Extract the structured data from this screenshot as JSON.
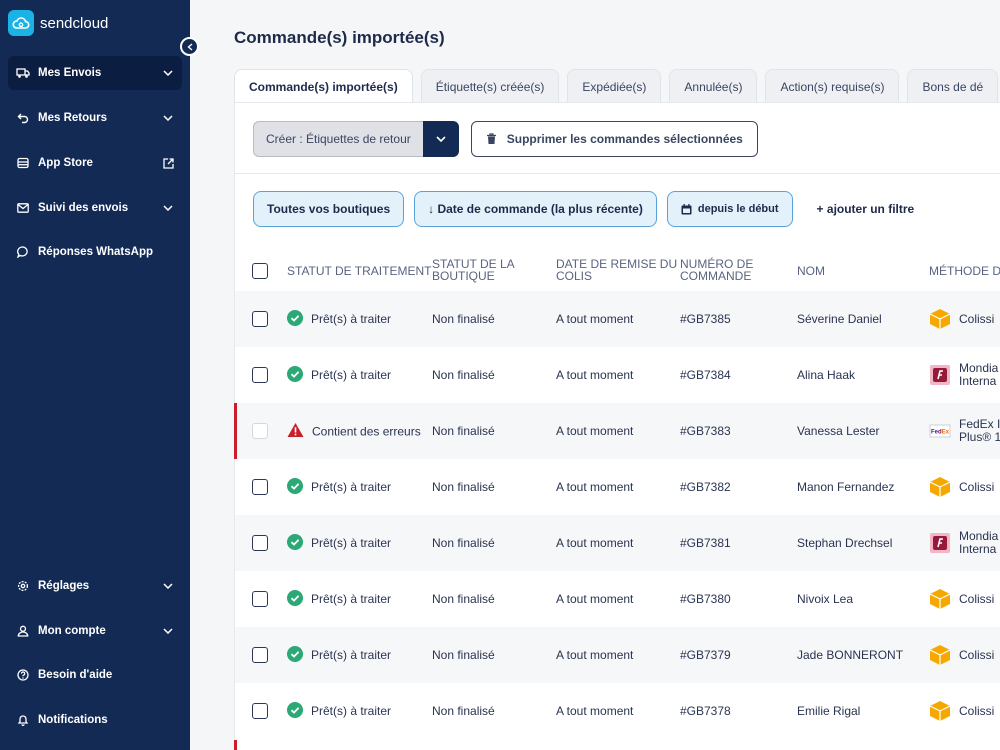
{
  "app": {
    "logo_text": "sendcloud"
  },
  "sidebar": {
    "top_items": [
      {
        "label": "Mes Envois",
        "icon": "truck-icon",
        "has_chevron": true,
        "active": true
      },
      {
        "label": "Mes Retours",
        "icon": "return-arrow-icon",
        "has_chevron": true
      },
      {
        "label": "App Store",
        "icon": "store-icon",
        "external": true
      },
      {
        "label": "Suivi des envois",
        "icon": "mail-icon",
        "has_chevron": true
      },
      {
        "label": "Réponses WhatsApp",
        "icon": "chat-bubble-icon"
      }
    ],
    "bottom_items": [
      {
        "label": "Réglages",
        "icon": "gear-icon",
        "has_chevron": true
      },
      {
        "label": "Mon compte",
        "icon": "user-icon",
        "has_chevron": true
      },
      {
        "label": "Besoin d'aide",
        "icon": "help-icon"
      },
      {
        "label": "Notifications",
        "icon": "bell-icon"
      }
    ]
  },
  "page": {
    "title": "Commande(s) importée(s)"
  },
  "tabs": [
    {
      "label": "Commande(s) importée(s)",
      "active": true
    },
    {
      "label": "Étiquette(s) créée(s)"
    },
    {
      "label": "Expédiée(s)"
    },
    {
      "label": "Annulée(s)"
    },
    {
      "label": "Action(s) requise(s)"
    },
    {
      "label": "Bons de dé"
    }
  ],
  "actions": {
    "create_label": "Créer : Étiquettes de retour",
    "delete_label": "Supprimer les commandes sélectionnées"
  },
  "filters": {
    "shops": "Toutes vos boutiques",
    "sort": "↓ Date de commande (la plus récente)",
    "date": "depuis le début",
    "add": "+ ajouter un filtre"
  },
  "table": {
    "headers": {
      "status": "STATUT DE TRAITEMENT",
      "shop_status_1": "STATUT DE LA",
      "shop_status_2": "BOUTIQUE",
      "handover_1": "DATE DE REMISE DU",
      "handover_2": "COLIS",
      "order_1": "NUMÉRO DE",
      "order_2": "COMMANDE",
      "name": "NOM",
      "method": "MÉTHODE D'"
    },
    "rows": [
      {
        "status": "Prêt(s) à traiter",
        "status_type": "ok",
        "shop_status": "Non finalisé",
        "handover": "A tout moment",
        "order": "#GB7385",
        "name": "Séverine Daniel",
        "carrier_type": "colissimo",
        "method_1": "Colissi",
        "method_2": ""
      },
      {
        "status": "Prêt(s) à traiter",
        "status_type": "ok",
        "shop_status": "Non finalisé",
        "handover": "A tout moment",
        "order": "#GB7384",
        "name": "Alina Haak",
        "carrier_type": "mondial",
        "method_1": "Mondia",
        "method_2": "Interna"
      },
      {
        "status": "Contient des erreurs",
        "status_type": "error",
        "shop_status": "Non finalisé",
        "handover": "A tout moment",
        "order": "#GB7383",
        "name": "Vanessa Lester",
        "carrier_type": "fedex",
        "method_1": "FedEx I",
        "method_2": "Plus® 1"
      },
      {
        "status": "Prêt(s) à traiter",
        "status_type": "ok",
        "shop_status": "Non finalisé",
        "handover": "A tout moment",
        "order": "#GB7382",
        "name": "Manon Fernandez",
        "carrier_type": "colissimo",
        "method_1": "Colissi",
        "method_2": ""
      },
      {
        "status": "Prêt(s) à traiter",
        "status_type": "ok",
        "shop_status": "Non finalisé",
        "handover": "A tout moment",
        "order": "#GB7381",
        "name": "Stephan Drechsel",
        "carrier_type": "mondial",
        "method_1": "Mondia",
        "method_2": "Interna"
      },
      {
        "status": "Prêt(s) à traiter",
        "status_type": "ok",
        "shop_status": "Non finalisé",
        "handover": "A tout moment",
        "order": "#GB7380",
        "name": "Nivoix Lea",
        "carrier_type": "colissimo",
        "method_1": "Colissi",
        "method_2": ""
      },
      {
        "status": "Prêt(s) à traiter",
        "status_type": "ok",
        "shop_status": "Non finalisé",
        "handover": "A tout moment",
        "order": "#GB7379",
        "name": "Jade BONNERONT",
        "carrier_type": "colissimo",
        "method_1": "Colissi",
        "method_2": ""
      },
      {
        "status": "Prêt(s) à traiter",
        "status_type": "ok",
        "shop_status": "Non finalisé",
        "handover": "A tout moment",
        "order": "#GB7378",
        "name": "Emilie Rigal",
        "carrier_type": "colissimo",
        "method_1": "Colissi",
        "method_2": ""
      }
    ]
  },
  "colors": {
    "sidebar_bg": "#132a55",
    "accent": "#1bb3e6",
    "ok_green": "#2aa876",
    "error_red": "#c8202a",
    "chip_bg": "#e3f1fb"
  }
}
